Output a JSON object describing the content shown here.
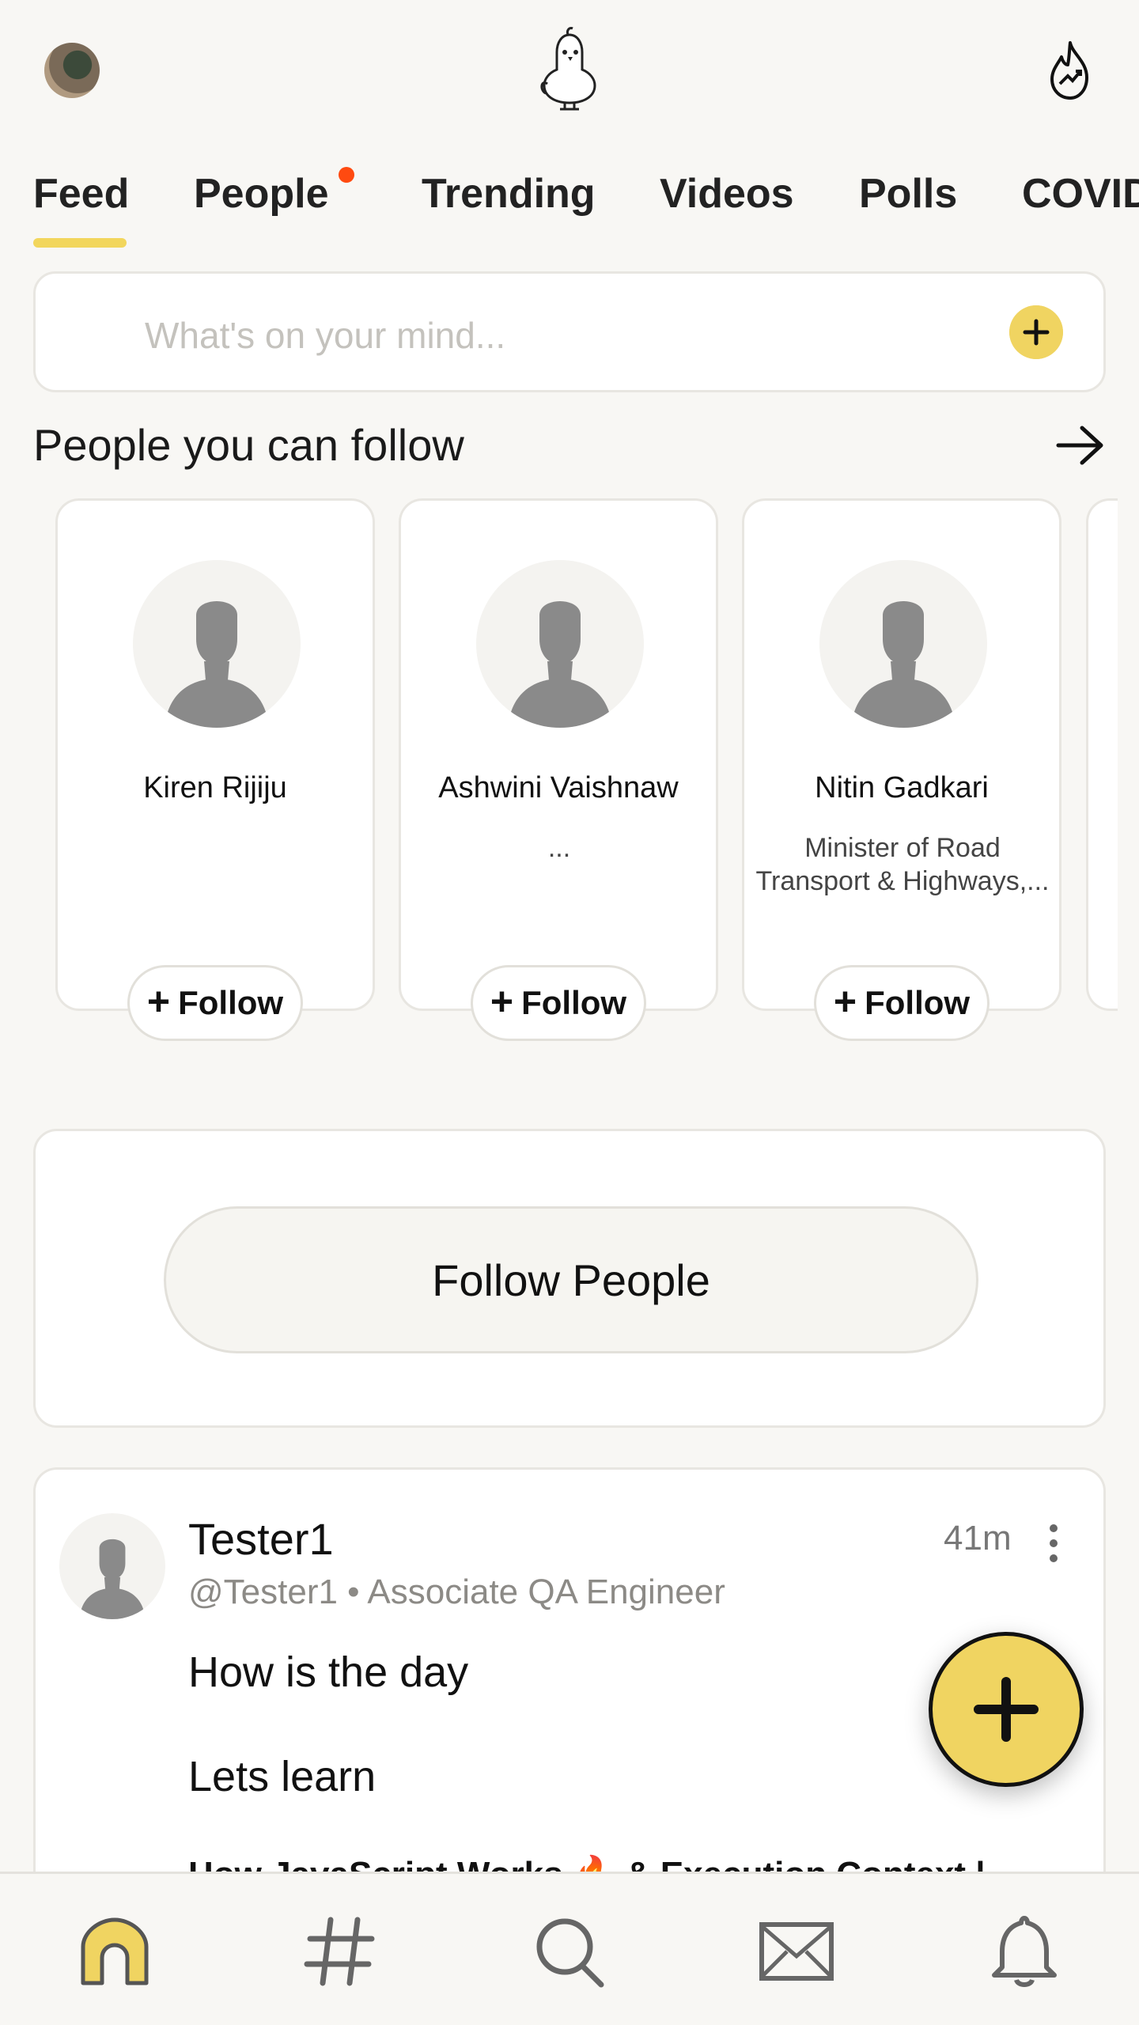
{
  "header": {
    "profile_icon": "user-avatar",
    "logo_icon": "koo-bird-logo",
    "trending_icon": "flame-trend-icon"
  },
  "tabs": [
    {
      "label": "Feed",
      "active": true
    },
    {
      "label": "People",
      "has_notification_dot": true
    },
    {
      "label": "Trending"
    },
    {
      "label": "Videos"
    },
    {
      "label": "Polls"
    },
    {
      "label": "COVID"
    }
  ],
  "composer": {
    "placeholder": "What's on your mind..."
  },
  "suggestions": {
    "title": "People you can follow",
    "people": [
      {
        "name": "Kiren Rijiju",
        "description": "",
        "follow_label": "Follow"
      },
      {
        "name": "Ashwini Vaishnaw",
        "description": "...",
        "follow_label": "Follow"
      },
      {
        "name": "Nitin Gadkari",
        "description": "Minister of Road Transport & Highways,...",
        "follow_label": "Follow"
      }
    ]
  },
  "follow_people": {
    "label": "Follow People"
  },
  "post": {
    "author": "Tester1",
    "handle_line": "@Tester1 • Associate QA Engineer",
    "time": "41m",
    "line1": "How is the day",
    "line2": "Lets learn",
    "line3": "How JavaScript Works 🔥 & Execution Context |"
  },
  "bottom_nav": [
    {
      "icon": "home-icon",
      "active": true
    },
    {
      "icon": "hashtag-icon"
    },
    {
      "icon": "search-icon"
    },
    {
      "icon": "mail-icon"
    },
    {
      "icon": "bell-icon"
    }
  ],
  "colors": {
    "accent": "#f0d461",
    "notification": "#ff4a10",
    "background": "#f8f7f4"
  }
}
